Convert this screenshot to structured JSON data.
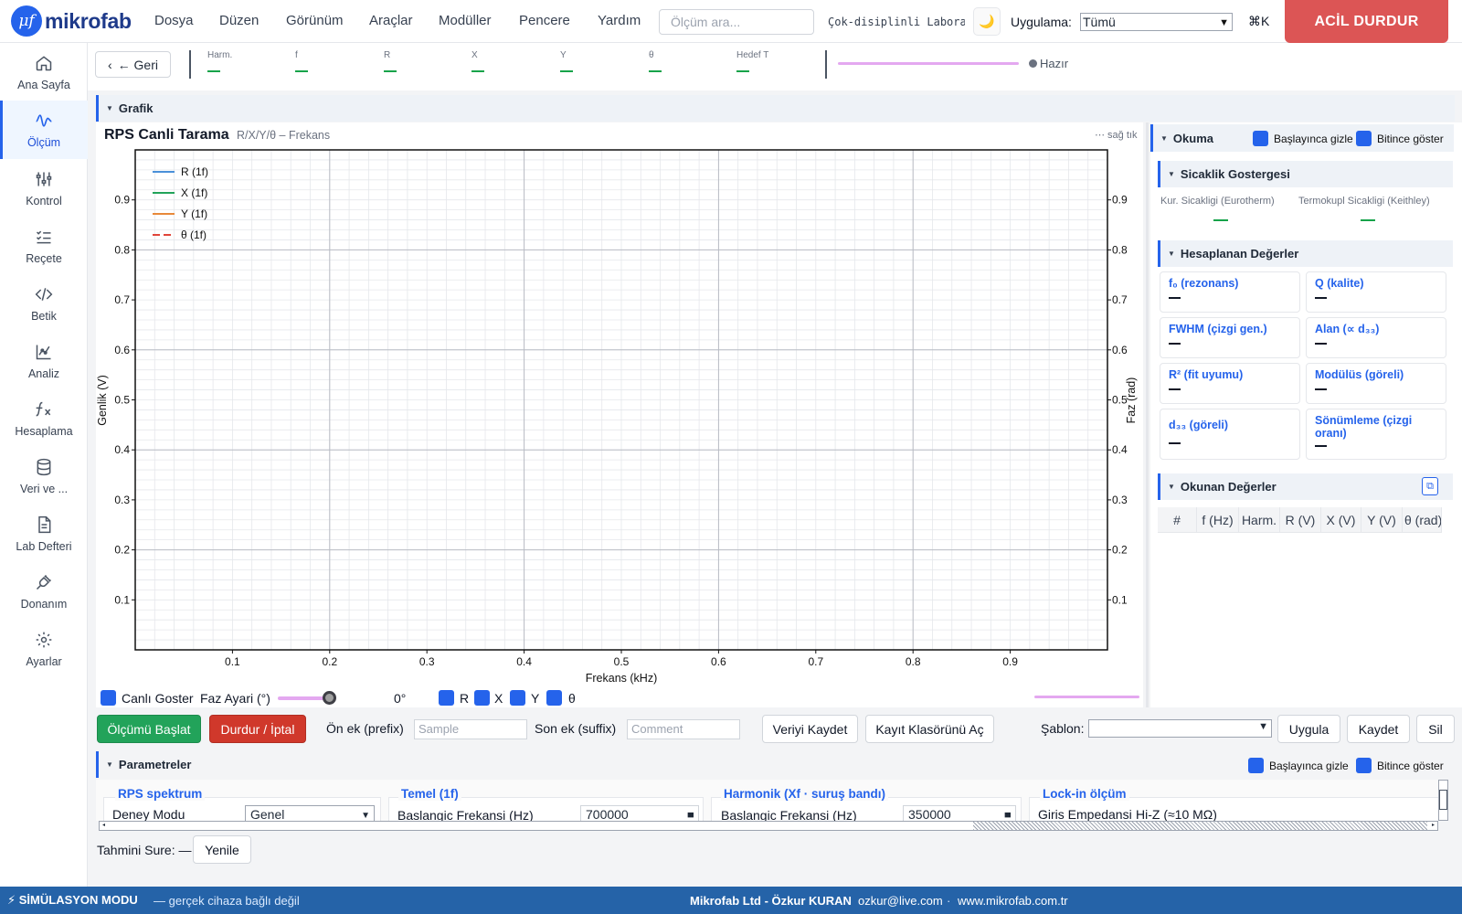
{
  "app": {
    "logo_mark": "μf",
    "logo_text": "mikrofab"
  },
  "menu": [
    "Dosya",
    "Düzen",
    "Görünüm",
    "Araçlar",
    "Modüller",
    "Pencere",
    "Yardım"
  ],
  "search": {
    "placeholder": "Ölçüm ara..."
  },
  "lab_text": "Çok-disiplinli Laboratuvar",
  "app_select": {
    "label": "Uygulama:",
    "value": "Tümü"
  },
  "shortcut": "⌘K",
  "estop_label": "ACİL DURDUR",
  "nav": [
    {
      "label": "Ana Sayfa",
      "icon": "home-icon"
    },
    {
      "label": "Ölçüm",
      "icon": "waveform-icon"
    },
    {
      "label": "Kontrol",
      "icon": "sliders-icon"
    },
    {
      "label": "Reçete",
      "icon": "checklist-icon"
    },
    {
      "label": "Betik",
      "icon": "code-icon"
    },
    {
      "label": "Analiz",
      "icon": "chart-icon"
    },
    {
      "label": "Hesaplama",
      "icon": "function-icon"
    },
    {
      "label": "Veri ve ...",
      "icon": "database-icon"
    },
    {
      "label": "Lab Defteri",
      "icon": "notebook-icon"
    },
    {
      "label": "Donanım",
      "icon": "plug-icon"
    },
    {
      "label": "Ayarlar",
      "icon": "gear-icon"
    }
  ],
  "readout": {
    "back_label": "← Geri",
    "fields": [
      {
        "key": "Harm.",
        "value": "—"
      },
      {
        "key": "f",
        "value": "—"
      },
      {
        "key": "R",
        "value": "—"
      },
      {
        "key": "X",
        "value": "—"
      },
      {
        "key": "Y",
        "value": "—"
      },
      {
        "key": "θ",
        "value": "—"
      },
      {
        "key": "Hedef T",
        "value": "—"
      }
    ],
    "status": "Hazır"
  },
  "graph_section": "Grafik",
  "chart_data": {
    "type": "line",
    "title": "RPS Canli Tarama",
    "subtitle": "R/X/Y/θ – Frekans",
    "hint": "⋯ sağ tık",
    "xlabel": "Frekans (kHz)",
    "ylabel": "Genlik (V)",
    "y2label": "Faz (rad)",
    "xlim": [
      0,
      1
    ],
    "ylim": [
      0,
      1
    ],
    "y2lim": [
      0,
      1
    ],
    "xticks": [
      "0.1",
      "0.2",
      "0.3",
      "0.4",
      "0.5",
      "0.6",
      "0.7",
      "0.8",
      "0.9"
    ],
    "yticks": [
      "0.1",
      "0.2",
      "0.3",
      "0.4",
      "0.5",
      "0.6",
      "0.7",
      "0.8",
      "0.9"
    ],
    "grid": true,
    "legend_position": "top-left",
    "series": [
      {
        "name": "R (1f)",
        "color": "#4a90d9",
        "dash": false,
        "values": []
      },
      {
        "name": "X (1f)",
        "color": "#22a35a",
        "dash": false,
        "values": []
      },
      {
        "name": "Y (1f)",
        "color": "#e8893a",
        "dash": false,
        "values": []
      },
      {
        "name": "θ (1f)",
        "color": "#e0453a",
        "dash": true,
        "values": []
      }
    ]
  },
  "chart_controls": {
    "live_label": "Canlı Goster",
    "phase_label": "Faz Ayari (°)",
    "phase_value": "0°",
    "phase_fraction": 0.88,
    "toggles": [
      "R",
      "X",
      "Y",
      "θ"
    ]
  },
  "actions": {
    "start": "Ölçümü Başlat",
    "stop": "Durdur / İptal",
    "prefix_label": "Ön ek (prefix)",
    "prefix_placeholder": "Sample",
    "suffix_label": "Son ek (suffix)",
    "suffix_placeholder": "Comment",
    "save_data": "Veriyi Kaydet",
    "open_folder": "Kayıt Klasörünü Aç",
    "template_label": "Şablon:",
    "apply": "Uygula",
    "save": "Kaydet",
    "delete": "Sil"
  },
  "params": {
    "title": "Parametreler",
    "hide_on_start": "Başlayınca gizle",
    "show_on_finish": "Bitince göster",
    "groups": [
      {
        "title": "RPS spektrum",
        "field": "Deney Modu",
        "value": "Genel"
      },
      {
        "title": "Temel (1f)",
        "field": "Baslangic Frekansi (Hz)",
        "value": "700000"
      },
      {
        "title": "Harmonik (Xf · suruş bandı)",
        "field": "Baslangic Frekansi (Hz)",
        "value": "350000"
      },
      {
        "title": "Lock-in ölçüm",
        "field": "Giris Empedansi",
        "value": "Hi-Z (≈10 MΩ)"
      }
    ],
    "estimate_label": "Tahmini Sure: —",
    "refresh": "Yenile"
  },
  "right": {
    "reading_title": "Okuma",
    "hide_on_start": "Başlayınca gizle",
    "show_on_finish": "Bitince göster",
    "temp_title": "Sicaklik Gostergesi",
    "temp_fields": [
      {
        "label": "Kur. Sicakligi (Eurotherm)",
        "value": "—"
      },
      {
        "label": "Termokupl Sicakligi (Keithley)",
        "value": "—"
      }
    ],
    "calc_title": "Hesaplanan Değerler",
    "calc_cards": [
      {
        "label": "f₀ (rezonans)",
        "value": "—"
      },
      {
        "label": "Q (kalite)",
        "value": "—"
      },
      {
        "label": "FWHM (çizgi gen.)",
        "value": "—"
      },
      {
        "label": "Alan (∝ d₃₃)",
        "value": "—"
      },
      {
        "label": "R² (fit uyumu)",
        "value": "—"
      },
      {
        "label": "Modülüs (göreli)",
        "value": "—"
      },
      {
        "label": "d₃₃ (göreli)",
        "value": "—"
      },
      {
        "label": "Sönümleme (çizgi oranı)",
        "value": "—"
      }
    ],
    "table_title": "Okunan Değerler",
    "table_columns": [
      "#",
      "f (Hz)",
      "Harm.",
      "R (V)",
      "X (V)",
      "Y (V)",
      "θ (rad)"
    ]
  },
  "footer": {
    "mode": "SİMÜLASYON MODU",
    "mode_note": "— gerçek cihaza bağlı değil",
    "company": "Mikrofab Ltd - Özkur KURAN",
    "email": "ozkur@live.com",
    "site": "www.mikrofab.com.tr"
  },
  "colors": {
    "accent": "#2563eb",
    "estop": "#dc5555",
    "start": "#22a35a",
    "stop": "#d0382b",
    "footer": "#2563a8"
  }
}
